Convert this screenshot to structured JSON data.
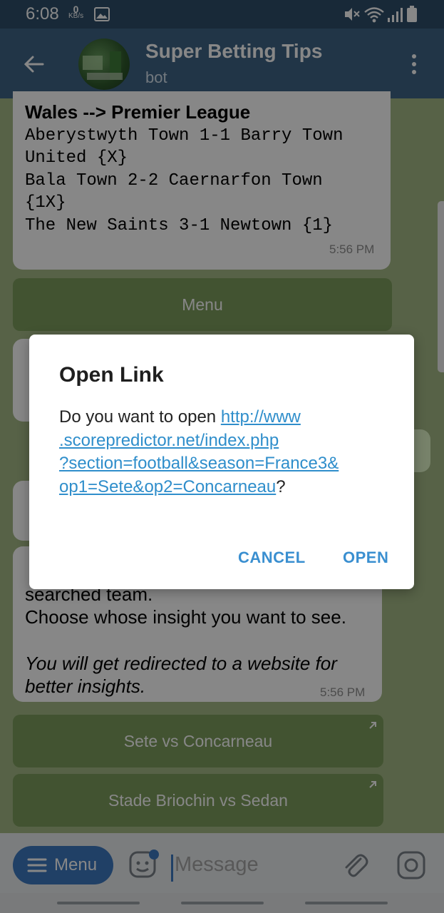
{
  "status": {
    "time": "6:08",
    "net_speed_value": "0",
    "net_speed_unit": "KB/s"
  },
  "header": {
    "title": "Super Betting Tips",
    "subtitle": "bot"
  },
  "chat": {
    "message1": {
      "heading": "Wales --> Premier League",
      "lines": [
        "Aberystwyth Town 1-1 Barry Town",
        "United {X}",
        "Bala Town 2-2 Caernarfon Town",
        "{1X}",
        "The New Saints 3-1 Newtown {1}"
      ],
      "time": "5:56 PM"
    },
    "menu_button_label": "Menu",
    "message4": {
      "line1": "searched team.",
      "line2": "Choose whose insight you want to see.",
      "italic1": "You will get redirected to a website for",
      "italic2": "better insights.",
      "time": "5:56 PM"
    },
    "inline_buttons": [
      "Sete vs Concarneau",
      "Stade Briochin vs Sedan"
    ]
  },
  "dialog": {
    "title": "Open Link",
    "body_prefix": "Do you want to open ",
    "link_lines": [
      "http://www",
      ".scorepredictor.net/index.php",
      "?section=football&season=France3&",
      "op1=Sete&op2=Concarneau"
    ],
    "body_suffix": "?",
    "cancel_label": "CANCEL",
    "open_label": "OPEN"
  },
  "input": {
    "menu_label": "Menu",
    "placeholder": "Message"
  },
  "colors": {
    "header": "#3f6587",
    "statusbar": "#2e4e6a",
    "chat_bg": "#a5b986",
    "link": "#2f8ecb",
    "accent": "#3a8fd0",
    "menu_pill": "#3e7ac0"
  },
  "icons": [
    "back-arrow-icon",
    "more-vert-icon",
    "mute-icon",
    "wifi-icon",
    "signal-icon",
    "battery-icon",
    "image-icon",
    "sticker-icon",
    "attach-icon",
    "camera-icon",
    "menu-lines-icon",
    "external-link-icon"
  ]
}
